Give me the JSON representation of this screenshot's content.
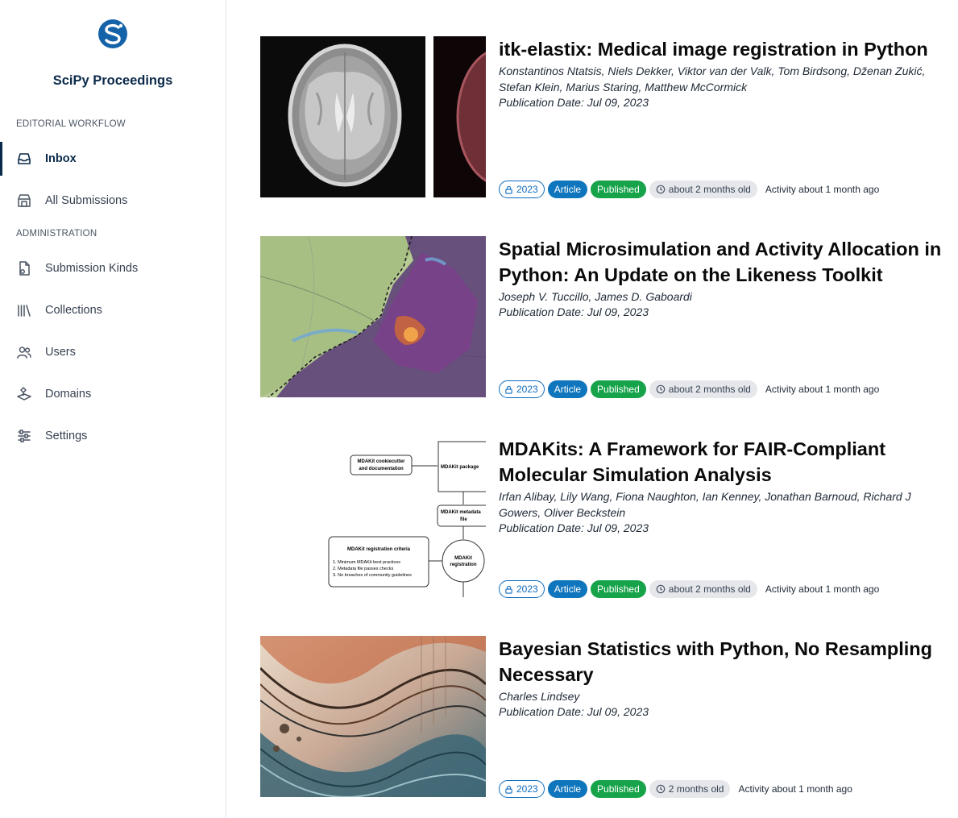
{
  "app": {
    "title": "SciPy Proceedings",
    "brand_color": "#0b2a4a",
    "logo_color": "#1462a8"
  },
  "sidebar": {
    "sections": [
      {
        "label": "EDITORIAL WORKFLOW"
      },
      {
        "label": "ADMINISTRATION"
      }
    ],
    "items": [
      {
        "label": "Inbox",
        "icon": "inbox-icon",
        "active": true
      },
      {
        "label": "All Submissions",
        "icon": "archive-icon"
      },
      {
        "label": "Submission Kinds",
        "icon": "document-icon"
      },
      {
        "label": "Collections",
        "icon": "library-icon"
      },
      {
        "label": "Users",
        "icon": "users-icon"
      },
      {
        "label": "Domains",
        "icon": "domains-icon"
      },
      {
        "label": "Settings",
        "icon": "sliders-icon"
      }
    ]
  },
  "submissions": [
    {
      "title": "itk-elastix: Medical image registration in Python",
      "authors": "Konstantinos Ntatsis, Niels Dekker, Viktor van der Valk, Tom Birdsong, Dženan Zukić, Stefan Klein, Marius Staring, Matthew McCormick",
      "date": "Publication Date: Jul 09, 2023",
      "year": "2023",
      "kind": "Article",
      "status": "Published",
      "age": "about 2 months old",
      "activity": "Activity about 1 month ago"
    },
    {
      "title": "Spatial Microsimulation and Activity Allocation in Python: An Update on the Likeness Toolkit",
      "authors": "Joseph V. Tuccillo, James D. Gaboardi",
      "date": "Publication Date: Jul 09, 2023",
      "year": "2023",
      "kind": "Article",
      "status": "Published",
      "age": "about 2 months old",
      "activity": "Activity about 1 month ago"
    },
    {
      "title": "MDAKits: A Framework for FAIR-Compliant Molecular Simulation Analysis",
      "authors": "Irfan Alibay, Lily Wang, Fiona Naughton, Ian Kenney, Jonathan Barnoud, Richard J Gowers, Oliver Beckstein",
      "date": "Publication Date: Jul 09, 2023",
      "year": "2023",
      "kind": "Article",
      "status": "Published",
      "age": "about 2 months old",
      "activity": "Activity about 1 month ago",
      "diagram": {
        "cookiecutter": "MDAKit cookiecutter and documentation",
        "package": "MDAKit package",
        "metadata": "MDAKit metadata file",
        "registration": "MDAKit registration",
        "criteria_title": "MDAKit registration criteria",
        "criteria_1": "1. Minimum MDAKit best practices",
        "criteria_2": "2. Metadata file passes checks",
        "criteria_3": "3. No breaches of community guidelines"
      }
    },
    {
      "title": "Bayesian Statistics with Python, No Resampling Necessary",
      "authors": "Charles Lindsey",
      "date": "Publication Date: Jul 09, 2023",
      "year": "2023",
      "kind": "Article",
      "status": "Published",
      "age": "2 months old",
      "activity": "Activity about 1 month ago"
    }
  ]
}
